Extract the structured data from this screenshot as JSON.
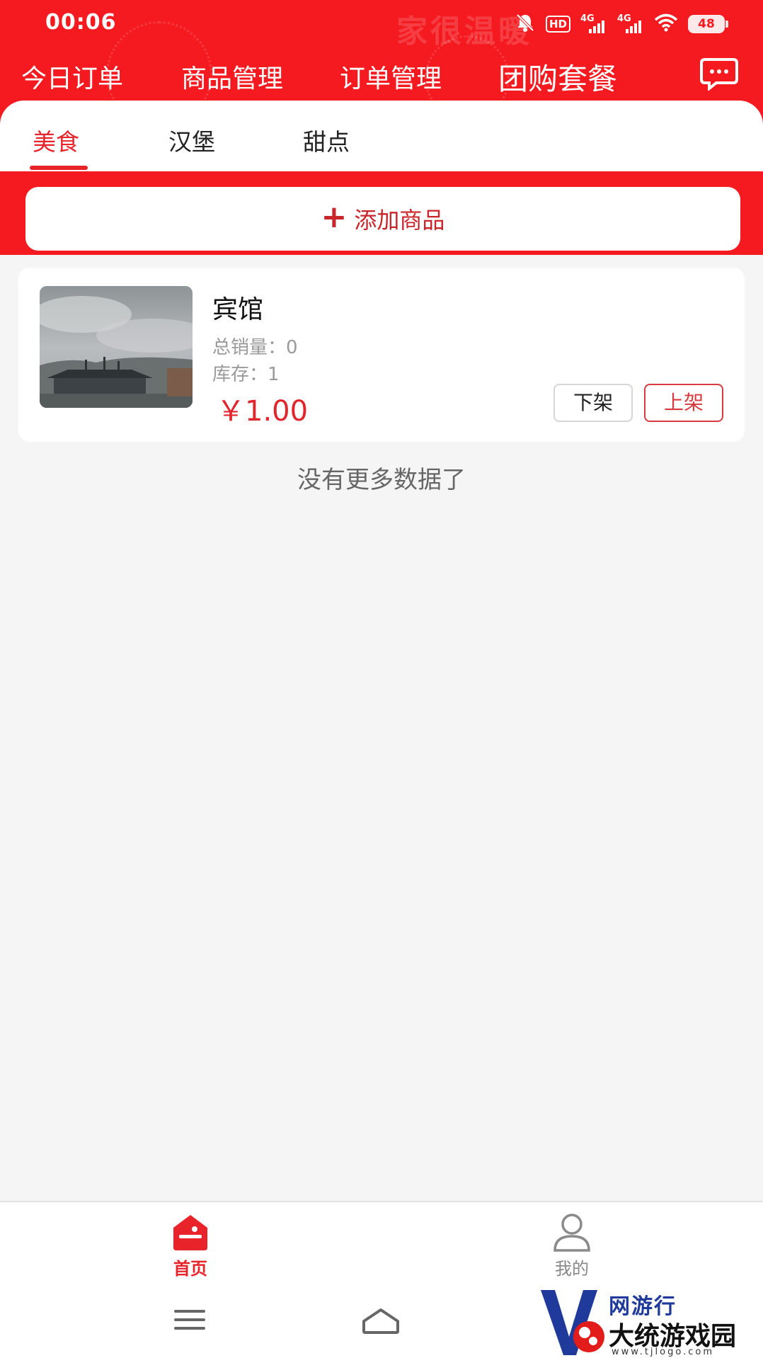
{
  "status_bar": {
    "time": "00:06",
    "hd_badge": "HD",
    "net1": "4G",
    "net2": "4G",
    "battery": "48"
  },
  "top_nav": {
    "items": [
      "今日订单",
      "商品管理",
      "订单管理",
      "团购套餐"
    ],
    "active_index": 3,
    "decoration_text": "家很温暖"
  },
  "category_tabs": {
    "items": [
      "美食",
      "汉堡",
      "甜点"
    ],
    "active_index": 0
  },
  "add_product": {
    "icon": "+",
    "label": "添加商品"
  },
  "products": [
    {
      "name": "宾馆",
      "total_sales_label": "总销量：",
      "total_sales": "0",
      "stock_label": "库存：",
      "stock": "1",
      "price": "￥1.00",
      "off_shelf_label": "下架",
      "on_shelf_label": "上架"
    }
  ],
  "list_footer": "没有更多数据了",
  "bottom_tabs": [
    {
      "label": "首页",
      "icon": "home-icon",
      "active": true
    },
    {
      "label": "我的",
      "icon": "user-icon",
      "active": false
    }
  ],
  "watermark": {
    "top_text": "网游行",
    "main_text": "大统游戏园",
    "url": "www.tjlogo.com"
  },
  "colors": {
    "brand_red": "#f41a1f",
    "price_red": "#e0252b",
    "background": "#f5f5f5"
  }
}
